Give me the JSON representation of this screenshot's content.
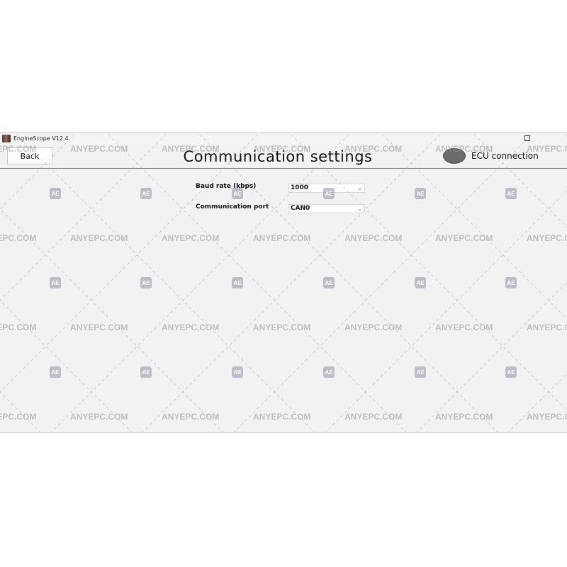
{
  "window": {
    "title": "EngineScope V12.4"
  },
  "toolbar": {
    "back_label": "Back",
    "page_title": "Communication settings",
    "ecu_label": "ECU connection",
    "ecu_status_color": "#6b6b6b"
  },
  "form": {
    "baud_rate": {
      "label": "Baud rate (kbps)",
      "value": "1000"
    },
    "comm_port": {
      "label": "Communication port",
      "value": "CAN0"
    }
  },
  "watermark": {
    "text": "ANYEPC.COM",
    "badge": "AE"
  },
  "icons": {
    "chevron": "chevron-down-icon",
    "app": "app-icon",
    "maximize": "maximize-icon"
  }
}
